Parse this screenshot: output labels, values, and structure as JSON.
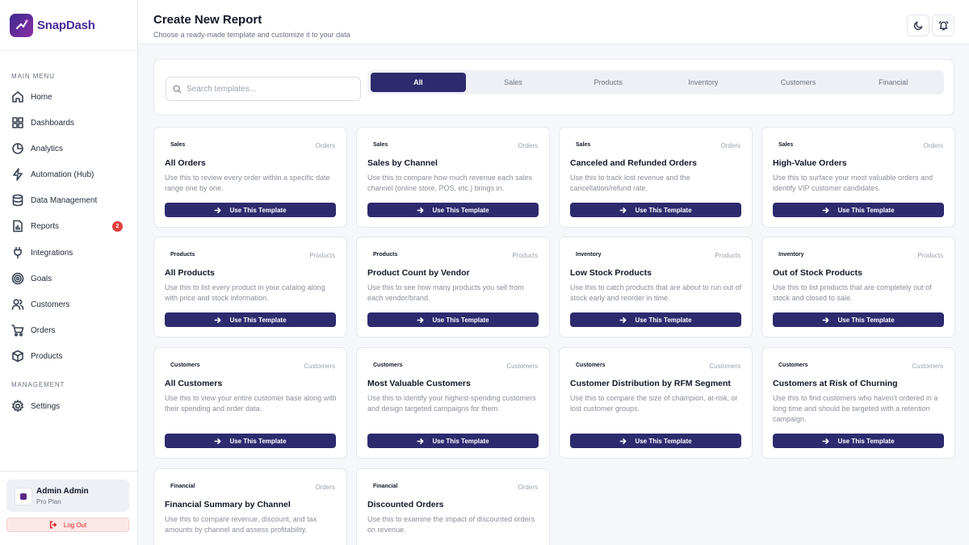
{
  "app": {
    "name": "SnapDash"
  },
  "sidebar": {
    "main_menu_label": "MAIN MENU",
    "management_label": "MANAGEMENT",
    "items": [
      {
        "label": "Home",
        "icon": "home-icon"
      },
      {
        "label": "Dashboards",
        "icon": "grid-icon"
      },
      {
        "label": "Analytics",
        "icon": "pie-chart-icon"
      },
      {
        "label": "Automation (Hub)",
        "icon": "lightning-icon"
      },
      {
        "label": "Data Management",
        "icon": "database-icon"
      },
      {
        "label": "Reports",
        "icon": "report-icon",
        "badge": "2"
      },
      {
        "label": "Integrations",
        "icon": "plug-icon"
      },
      {
        "label": "Goals",
        "icon": "target-icon"
      },
      {
        "label": "Customers",
        "icon": "users-icon"
      },
      {
        "label": "Orders",
        "icon": "cart-icon"
      },
      {
        "label": "Products",
        "icon": "box-icon"
      }
    ],
    "management_items": [
      {
        "label": "Settings",
        "icon": "gear-icon"
      }
    ],
    "user": {
      "name": "Admin Admin",
      "plan": "Pro Plan"
    },
    "logout_label": "Log Out"
  },
  "header": {
    "title": "Create New Report",
    "subtitle": "Choose a ready-made template and customize it to your data"
  },
  "search": {
    "placeholder": "Search templates...",
    "value": ""
  },
  "tabs": [
    "All",
    "Sales",
    "Products",
    "Inventory",
    "Customers",
    "Financial"
  ],
  "active_tab": "All",
  "button_label": "Use This Template",
  "templates": [
    {
      "category": "Sales",
      "source": "Orders",
      "title": "All Orders",
      "description": "Use this to review every order within a specific date range one by one."
    },
    {
      "category": "Sales",
      "source": "Orders",
      "title": "Sales by Channel",
      "description": "Use this to compare how much revenue each sales channel (online store, POS, etc.) brings in."
    },
    {
      "category": "Sales",
      "source": "Orders",
      "title": "Canceled and Refunded Orders",
      "description": "Use this to track lost revenue and the cancellation/refund rate."
    },
    {
      "category": "Sales",
      "source": "Orders",
      "title": "High-Value Orders",
      "description": "Use this to surface your most valuable orders and identify VIP customer candidates."
    },
    {
      "category": "Products",
      "source": "Products",
      "title": "All Products",
      "description": "Use this to list every product in your catalog along with price and stock information."
    },
    {
      "category": "Products",
      "source": "Products",
      "title": "Product Count by Vendor",
      "description": "Use this to see how many products you sell from each vendor/brand."
    },
    {
      "category": "Inventory",
      "source": "Products",
      "title": "Low Stock Products",
      "description": "Use this to catch products that are about to run out of stock early and reorder in time."
    },
    {
      "category": "Inventory",
      "source": "Products",
      "title": "Out of Stock Products",
      "description": "Use this to list products that are completely out of stock and closed to sale."
    },
    {
      "category": "Customers",
      "source": "Customers",
      "title": "All Customers",
      "description": "Use this to view your entire customer base along with their spending and order data."
    },
    {
      "category": "Customers",
      "source": "Customers",
      "title": "Most Valuable Customers",
      "description": "Use this to identify your highest-spending customers and design targeted campaigns for them."
    },
    {
      "category": "Customers",
      "source": "Customers",
      "title": "Customer Distribution by RFM Segment",
      "description": "Use this to compare the size of champion, at-risk, or lost customer groups."
    },
    {
      "category": "Customers",
      "source": "Customers",
      "title": "Customers at Risk of Churning",
      "description": "Use this to find customers who haven't ordered in a long time and should be targeted with a retention campaign."
    },
    {
      "category": "Financial",
      "source": "Orders",
      "title": "Financial Summary by Channel",
      "description": "Use this to compare revenue, discount, and tax amounts by channel and assess profitability."
    },
    {
      "category": "Financial",
      "source": "Orders",
      "title": "Discounted Orders",
      "description": "Use this to examine the impact of discounted orders on revenue."
    }
  ]
}
